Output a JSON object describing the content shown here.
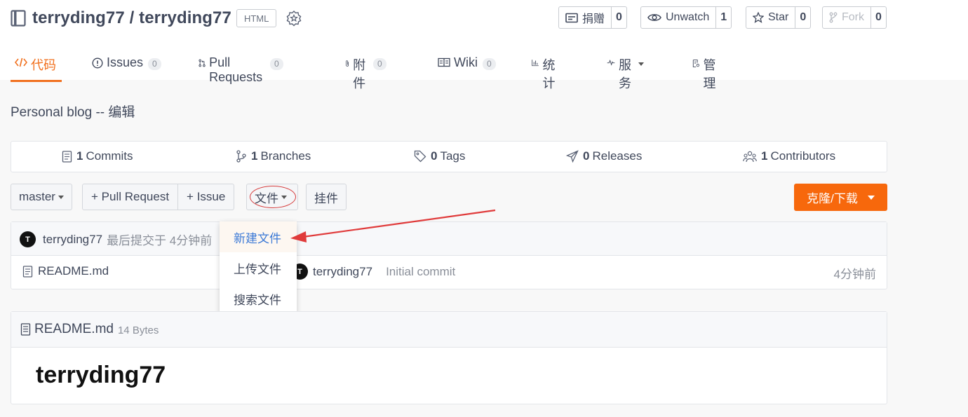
{
  "repo": {
    "title": "terryding77 / terryding77",
    "language": "HTML",
    "description": "Personal blog -- ",
    "edit_link": "编辑"
  },
  "social": {
    "donate": {
      "label": "捐赠",
      "count": "0"
    },
    "watch": {
      "label": "Unwatch",
      "count": "1"
    },
    "star": {
      "label": "Star",
      "count": "0"
    },
    "fork": {
      "label": "Fork",
      "count": "0"
    }
  },
  "tabs": [
    {
      "label": "代码",
      "active": true
    },
    {
      "label": "Issues",
      "count": "0"
    },
    {
      "label": "Pull Requests",
      "count": "0"
    },
    {
      "label": "附件",
      "count": "0"
    },
    {
      "label": "Wiki",
      "count": "0"
    },
    {
      "label": "统计"
    },
    {
      "label": "服务"
    },
    {
      "label": "管理"
    }
  ],
  "stats": {
    "commits": {
      "count": "1",
      "label": "Commits"
    },
    "branches": {
      "count": "1",
      "label": "Branches"
    },
    "tags": {
      "count": "0",
      "label": "Tags"
    },
    "releases": {
      "count": "0",
      "label": "Releases"
    },
    "contributors": {
      "count": "1",
      "label": "Contributors"
    }
  },
  "toolbar": {
    "branch": "master",
    "pull_request": "+ Pull Request",
    "issue": "+ Issue",
    "file": "文件",
    "widget": "挂件",
    "clone": "克隆/下载"
  },
  "file_menu": [
    "新建文件",
    "上传文件",
    "搜索文件"
  ],
  "latest_commit": {
    "avatar_letter": "T",
    "author": "terryding77",
    "meta": "最后提交于 4分钟前"
  },
  "files": [
    {
      "name": "README.md",
      "author": "terryding77",
      "avatar_letter": "T",
      "message": "Initial commit",
      "time": "4分钟前"
    }
  ],
  "readme": {
    "filename": "README.md",
    "size": "14 Bytes",
    "heading": "terryding77"
  },
  "colors": {
    "accent": "#f1701e",
    "clone_button": "#f7680c",
    "annotation": "#e03b3b",
    "link_highlight": "#3d7ad6"
  }
}
